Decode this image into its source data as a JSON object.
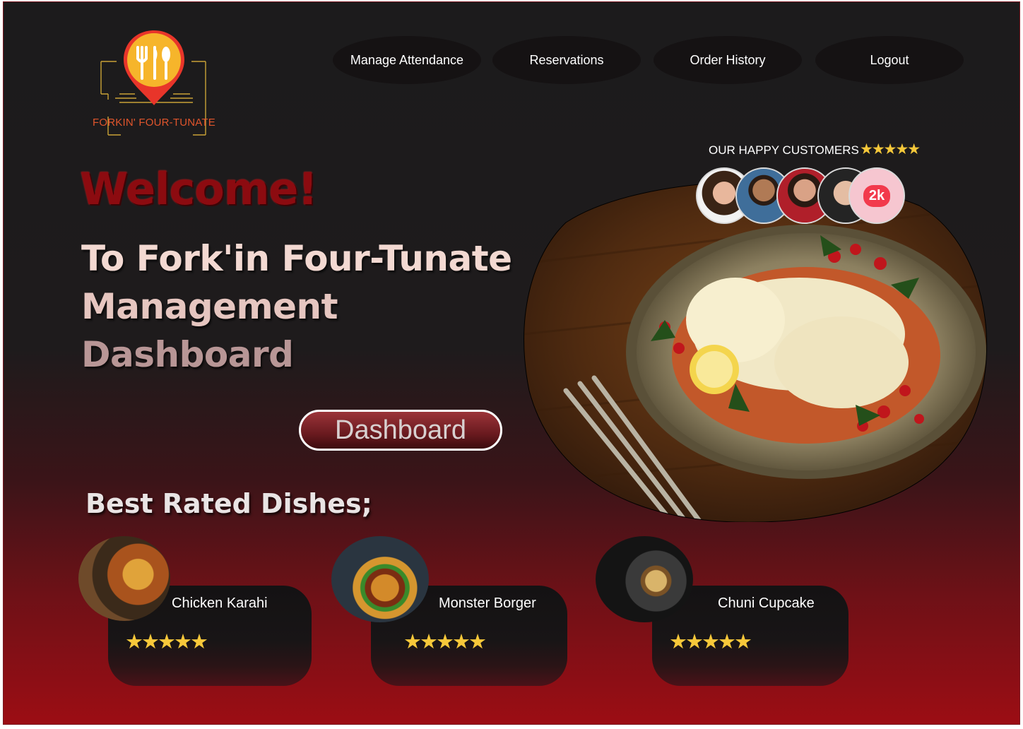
{
  "brand": {
    "name": "FORKIN' FOUR-TUNATE",
    "logo_icon": "map-pin-fork-knife-spoon-icon"
  },
  "nav": {
    "items": [
      {
        "label": "Manage Attendance"
      },
      {
        "label": "Reservations"
      },
      {
        "label": "Order History"
      },
      {
        "label": "Logout"
      }
    ]
  },
  "hero": {
    "welcome": "Welcome!",
    "subtitle_lines": [
      "To Fork'in Four-Tunate",
      "Management",
      "Dashboard"
    ],
    "dashboard_button": "Dashboard"
  },
  "customers": {
    "label": "OUR HAPPY CUSTOMERS",
    "stars": "★★★★★",
    "count_badge": "2k"
  },
  "best_rated": {
    "title": "Best Rated Dishes;",
    "dishes": [
      {
        "name": "Chicken Karahi",
        "stars": "★★★★★",
        "rating": 5
      },
      {
        "name": "Monster Borger",
        "stars": "★★★★★",
        "rating": 5
      },
      {
        "name": "Chuni Cupcake",
        "stars": "★★★★★",
        "rating": 5
      }
    ]
  },
  "colors": {
    "accent_red": "#8c0b10",
    "star_gold": "#f6c83a",
    "logo_orange": "#e0552c"
  }
}
